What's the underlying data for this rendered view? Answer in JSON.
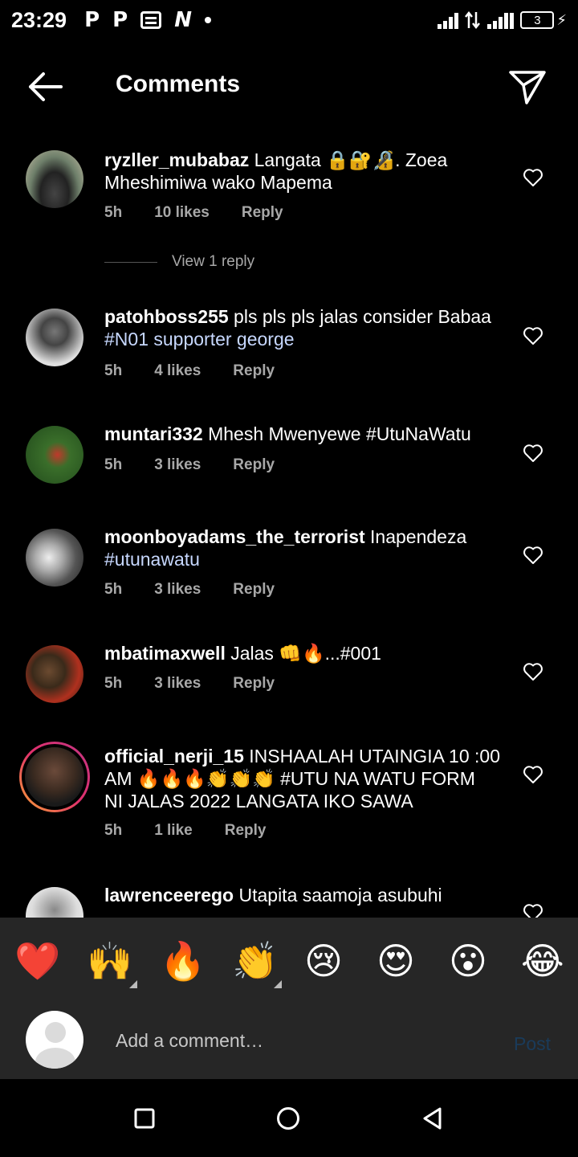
{
  "status_bar": {
    "time": "23:29",
    "notifications": [
      "P",
      "P",
      "N"
    ],
    "battery": "3"
  },
  "header": {
    "title": "Comments",
    "back_icon": "arrow-left-icon",
    "share_icon": "paper-plane-icon"
  },
  "comments": [
    {
      "username": "ryzller_mubabaz",
      "lines": [
        "Langata 🔒🔐🔏. Zoea",
        "Mheshimiwa wako Mapema"
      ],
      "time": "5h",
      "likes": "10 likes",
      "reply": "Reply",
      "view_replies": "View 1 reply"
    },
    {
      "username": "patohboss255",
      "lines": [
        "pls pls pls jalas consider Babaa",
        "#N01 supporter george"
      ],
      "time": "5h",
      "likes": "4 likes",
      "reply": "Reply"
    },
    {
      "username": "muntari332",
      "lines": [
        "Mhesh Mwenyewe #UtuNaWatu"
      ],
      "time": "5h",
      "likes": "3 likes",
      "reply": "Reply"
    },
    {
      "username": "moonboyadams_the_terrorist",
      "lines": [
        "Inapendeza",
        "#utunawatu"
      ],
      "time": "5h",
      "likes": "3 likes",
      "reply": "Reply"
    },
    {
      "username": "mbatimaxwell",
      "lines": [
        "Jalas 👊🔥...#001"
      ],
      "time": "5h",
      "likes": "3 likes",
      "reply": "Reply"
    },
    {
      "username": "official_nerji_15",
      "lines": [
        "INSHAALAH UTAINGIA 10 :00",
        "AM 🔥🔥🔥👏👏👏 #UTU NA WATU FORM",
        "NI JALAS 2022 LANGATA IKO SAWA"
      ],
      "time": "5h",
      "likes": "1 like",
      "reply": "Reply"
    },
    {
      "username": "lawrenceerego",
      "lines": [
        "Utapita saamoja asubuhi"
      ]
    }
  ],
  "emoji_bar": {
    "emojis": [
      "❤️",
      "🙌",
      "🔥",
      "👏",
      "😢",
      "😍",
      "😮",
      "😂"
    ]
  },
  "comment_input": {
    "placeholder": "Add a comment…",
    "post_label": "Post"
  },
  "colors": {
    "background": "#000000",
    "panel": "#262626",
    "meta_text": "#a8a8a8",
    "hashtag": "#c7d8ff",
    "post_disabled": "#1a3b5a"
  }
}
